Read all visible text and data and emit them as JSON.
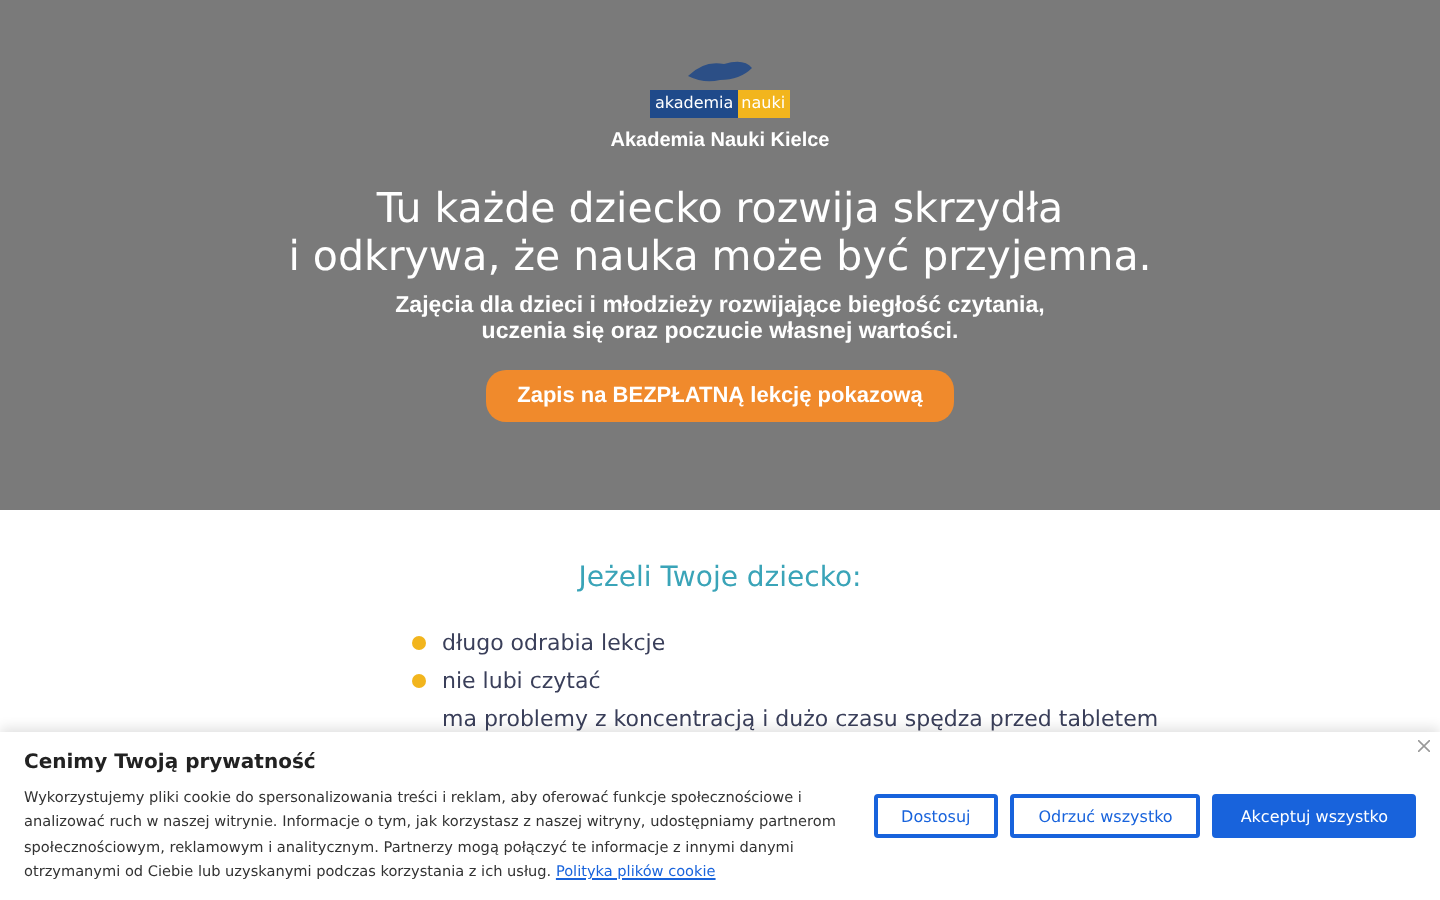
{
  "hero": {
    "logo_left": "akademia",
    "logo_right": "nauki",
    "site_name": "Akademia Nauki Kielce",
    "headline": [
      "Tu każde dziecko rozwija skrzydła",
      "i odkrywa, że nauka może być przyjemna."
    ],
    "subheadline": [
      "Zajęcia dla dzieci i młodzieży rozwijające biegłość czytania,",
      "uczenia się oraz poczucie własnej wartości."
    ],
    "cta": "Zapis na BEZPŁATNĄ lekcję pokazową"
  },
  "section": {
    "title": "Jeżeli Twoje dziecko:",
    "items": [
      {
        "text": "długo odrabia lekcje",
        "bullet": true
      },
      {
        "text": "nie lubi czytać",
        "bullet": true
      },
      {
        "text": "ma problemy z koncentracją i dużo czasu spędza przed tabletem",
        "bullet": false
      }
    ]
  },
  "cookie_banner": {
    "title": "Cenimy Twoją prywatność",
    "body": "Wykorzystujemy pliki cookie do spersonalizowania treści i reklam, aby oferować funkcje społecznościowe i analizować ruch w naszej witrynie. Informacje o tym, jak korzystasz z naszej witryny, udostępniamy partnerom społecznościowym, reklamowym i analitycznym. Partnerzy mogą połączyć te informacje z innymi danymi otrzymanymi od Ciebie lub uzyskanymi podczas korzystania z ich usług.",
    "link": "Polityka plików cookie",
    "buttons": [
      {
        "label": "Dostosuj",
        "kind": "outline"
      },
      {
        "label": "Odrzuć wszystko",
        "kind": "outline"
      },
      {
        "label": "Akceptuj wszystko",
        "kind": "primary"
      }
    ]
  }
}
